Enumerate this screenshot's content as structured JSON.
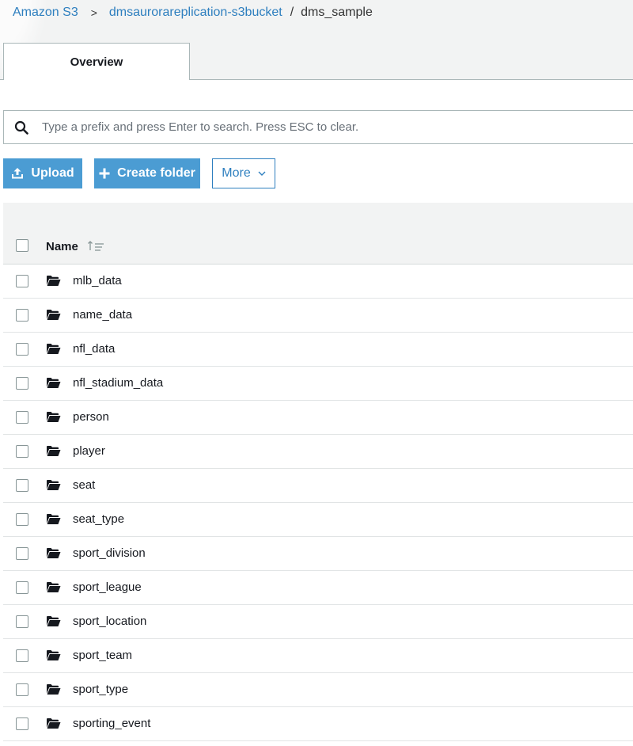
{
  "breadcrumb": {
    "root": "Amazon S3",
    "separator": ">",
    "bucket": "dmsaurorareplication-s3bucket",
    "slash": "/",
    "current": "dms_sample"
  },
  "tabs": [
    {
      "label": "Overview",
      "active": true
    }
  ],
  "search": {
    "placeholder": "Type a prefix and press Enter to search. Press ESC to clear.",
    "value": ""
  },
  "toolbar": {
    "upload_label": "Upload",
    "create_folder_label": "Create folder",
    "more_label": "More"
  },
  "table": {
    "column_name": "Name",
    "rows": [
      {
        "name": "mlb_data",
        "icon": "folder-icon"
      },
      {
        "name": "name_data",
        "icon": "folder-icon"
      },
      {
        "name": "nfl_data",
        "icon": "folder-icon"
      },
      {
        "name": "nfl_stadium_data",
        "icon": "folder-icon"
      },
      {
        "name": "person",
        "icon": "folder-icon"
      },
      {
        "name": "player",
        "icon": "folder-icon"
      },
      {
        "name": "seat",
        "icon": "folder-icon"
      },
      {
        "name": "seat_type",
        "icon": "folder-icon"
      },
      {
        "name": "sport_division",
        "icon": "folder-icon"
      },
      {
        "name": "sport_league",
        "icon": "folder-icon"
      },
      {
        "name": "sport_location",
        "icon": "folder-icon"
      },
      {
        "name": "sport_team",
        "icon": "folder-icon"
      },
      {
        "name": "sport_type",
        "icon": "folder-icon"
      },
      {
        "name": "sporting_event",
        "icon": "folder-icon"
      }
    ]
  },
  "colors": {
    "link": "#2e7fbf",
    "primary_button": "#4b9cd3",
    "border": "#aab7b8",
    "header_bg": "#f2f3f3"
  }
}
